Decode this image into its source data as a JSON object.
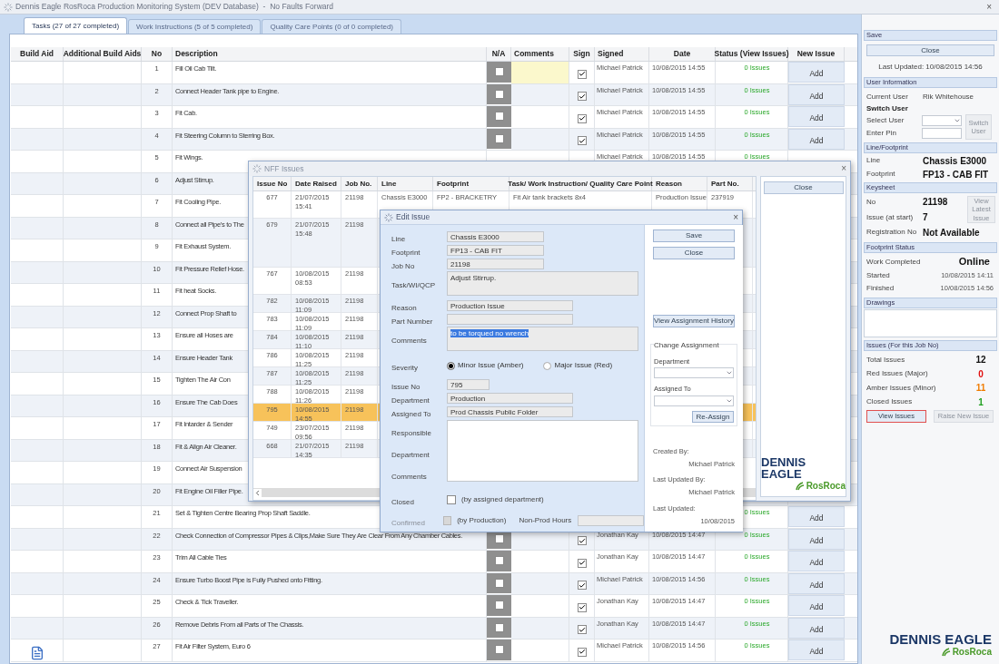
{
  "window": {
    "title": "Dennis Eagle RosRoca Production Monitoring System (DEV Database)  -  No Faults Forward",
    "close": "×"
  },
  "tabs": [
    {
      "label": "Tasks (27 of 27 completed)",
      "selected": true
    },
    {
      "label": "Work Instructions (5 of 5 completed)",
      "selected": false
    },
    {
      "label": "Quality Care Points (0 of 0 completed)",
      "selected": false
    }
  ],
  "tasks": {
    "columns": [
      "Build Aid",
      "Additional Build Aids",
      "No",
      "Description",
      "N/A",
      "Comments",
      "Sign",
      "Signed",
      "Date",
      "Status (View Issues)",
      "New Issue"
    ],
    "rows": [
      {
        "no": "1",
        "description": "Fill Oil Cab Tilt.",
        "attachment": false,
        "na": false,
        "editing": true,
        "sign": true,
        "signed": "Michael Patrick",
        "date": "10/08/2015 14:55",
        "status": "0 Issues",
        "add": "Add"
      },
      {
        "no": "2",
        "description": "Connect Header Tank pipe to Engine.",
        "attachment": false,
        "na": false,
        "editing": false,
        "sign": true,
        "signed": "Michael Patrick",
        "date": "10/08/2015 14:55",
        "status": "0 Issues",
        "add": "Add"
      },
      {
        "no": "3",
        "description": "Fit Cab.",
        "attachment": false,
        "na": false,
        "editing": false,
        "sign": true,
        "signed": "Michael Patrick",
        "date": "10/08/2015 14:55",
        "status": "0 Issues",
        "add": "Add"
      },
      {
        "no": "4",
        "description": "Fit Steering Column to Sterring Box.",
        "attachment": false,
        "na": false,
        "editing": false,
        "sign": true,
        "signed": "Michael Patrick",
        "date": "10/08/2015 14:55",
        "status": "0 Issues",
        "add": "Add"
      },
      {
        "no": "5",
        "description": "Fit Wings.",
        "attachment": false,
        "signed": "Michael Patrick",
        "date": "10/08/2015 14:55",
        "status": "0 Issues"
      },
      {
        "no": "6",
        "description": "Adjust Stirrup.",
        "attachment": false
      },
      {
        "no": "7",
        "description": "Fit Cooling Pipe.",
        "attachment": false
      },
      {
        "no": "8",
        "description": "Connect all Pipe's to The",
        "attachment": false
      },
      {
        "no": "9",
        "description": "Fit Exhaust System.",
        "attachment": false
      },
      {
        "no": "10",
        "description": "Fit Pressure Relief Hose.",
        "attachment": false
      },
      {
        "no": "11",
        "description": "Fit heat Socks.",
        "attachment": false
      },
      {
        "no": "12",
        "description": "Connect Prop Shaft to",
        "attachment": false
      },
      {
        "no": "13",
        "description": "Ensure all Hoses are",
        "attachment": false
      },
      {
        "no": "14",
        "description": "Ensure Header Tank",
        "attachment": false
      },
      {
        "no": "15",
        "description": "Tighten The Air Con",
        "attachment": false
      },
      {
        "no": "16",
        "description": "Ensure The Cab Does",
        "attachment": false
      },
      {
        "no": "17",
        "description": "Fit Intarder &  Sender",
        "attachment": false
      },
      {
        "no": "18",
        "description": "Fit & Align Air Cleaner.",
        "attachment": false
      },
      {
        "no": "19",
        "description": "Connect Air Suspension",
        "attachment": false
      },
      {
        "no": "20",
        "description": "Fit Engine Oil Filler Pipe.",
        "attachment": false
      },
      {
        "no": "21",
        "description": "Set & Tighten Centre Bearing Prop Shaft Saddle.",
        "attachment": false,
        "status": "0 Issues",
        "add": "Add"
      },
      {
        "no": "22",
        "description": "Check Connection of Compressor Pipes & Clips,Make Sure They Are Clear From Any Chamber Cables.",
        "attachment": false,
        "na": false,
        "editing": false,
        "sign": true,
        "signed": "Jonathan Kay",
        "date": "10/08/2015 14:47",
        "status": "0 Issues",
        "add": "Add"
      },
      {
        "no": "23",
        "description": "Trim All Cable Ties",
        "attachment": false,
        "na": false,
        "editing": false,
        "sign": true,
        "signed": "Jonathan Kay",
        "date": "10/08/2015 14:47",
        "status": "0 Issues",
        "add": "Add"
      },
      {
        "no": "24",
        "description": "Ensure Turbo Boost Pipe is Fully Pushed onto Fitting.",
        "attachment": false,
        "na": false,
        "editing": false,
        "sign": true,
        "signed": "Michael Patrick",
        "date": "10/08/2015 14:56",
        "status": "0 Issues",
        "add": "Add"
      },
      {
        "no": "25",
        "description": "Check & Tick Traveller.",
        "attachment": false,
        "na": false,
        "editing": false,
        "sign": true,
        "signed": "Jonathan Kay",
        "date": "10/08/2015 14:47",
        "status": "0 Issues",
        "add": "Add"
      },
      {
        "no": "26",
        "description": "Remove Debris From all Parts of The Chassis.",
        "attachment": false,
        "na": false,
        "editing": false,
        "sign": true,
        "signed": "Jonathan Kay",
        "date": "10/08/2015 14:47",
        "status": "0 Issues",
        "add": "Add"
      },
      {
        "no": "27",
        "description": "Fit Air Filter System, Euro 6",
        "attachment": true,
        "na": false,
        "editing": false,
        "sign": true,
        "signed": "Michael Patrick",
        "date": "10/08/2015 14:56",
        "status": "0 Issues",
        "add": "Add"
      }
    ]
  },
  "nff": {
    "title": "NFF Issues",
    "close": "×",
    "columns": [
      "Issue No",
      "Date Raised",
      "Job No.",
      "Line",
      "Footprint",
      "Task/ Work Instruction/ Quality Care Point",
      "Reason",
      "Part No."
    ],
    "rows": [
      {
        "issue_no": "677",
        "date": "21/07/2015 15:41",
        "job": "21198",
        "line": "Chassis E3000",
        "footprint": "FP2 - BRACKETRY",
        "task": "Fit Air tank brackets 8x4",
        "reason": "Production Issue",
        "part": "237919",
        "selected": false
      },
      {
        "issue_no": "679",
        "date": "21/07/2015 15:48",
        "job": "21198",
        "selected": false
      },
      {
        "issue_no": "767",
        "date": "10/08/2015 08:53",
        "job": "21198",
        "selected": false
      },
      {
        "issue_no": "782",
        "date": "10/08/2015 11:09",
        "job": "21198",
        "selected": false
      },
      {
        "issue_no": "783",
        "date": "10/08/2015 11:09",
        "job": "21198",
        "selected": false
      },
      {
        "issue_no": "784",
        "date": "10/08/2015 11:10",
        "job": "21198",
        "selected": false
      },
      {
        "issue_no": "786",
        "date": "10/08/2015 11:25",
        "job": "21198",
        "selected": false
      },
      {
        "issue_no": "787",
        "date": "10/08/2015 11:25",
        "job": "21198",
        "selected": false
      },
      {
        "issue_no": "788",
        "date": "10/08/2015 11:26",
        "job": "21198",
        "selected": false
      },
      {
        "issue_no": "795",
        "date": "10/08/2015 14:55",
        "job": "21198",
        "selected": true
      },
      {
        "issue_no": "749",
        "date": "23/07/2015 09:56",
        "job": "21198",
        "selected": false
      },
      {
        "issue_no": "668",
        "date": "21/07/2015 14:35",
        "job": "21198",
        "selected": false
      }
    ],
    "close_button": "Close",
    "logo": {
      "name": "DENNIS EAGLE",
      "sub": "RosRoca"
    }
  },
  "edit": {
    "title": "Edit Issue",
    "close": "×",
    "fields": [
      {
        "kind": "text",
        "label": "Line",
        "value": "Chassis E3000"
      },
      {
        "kind": "text",
        "label": "Footprint",
        "value": "FP13 - CAB FIT"
      },
      {
        "kind": "text",
        "label": "Job No",
        "value": "21198"
      },
      {
        "kind": "area",
        "label": "Task/WI/QCP",
        "value": "Adjust Stirrup.",
        "highlighted": false
      },
      {
        "kind": "wide",
        "label": "Reason",
        "value": "Production Issue"
      },
      {
        "kind": "wide",
        "label": "Part Number"
      },
      {
        "kind": "area",
        "label": "Comments",
        "value": "to be torqued no wrench",
        "highlighted": true
      },
      {
        "kind": "radio",
        "label": "Severity",
        "options": [
          {
            "label": "Minor Issue (Amber)",
            "selected": true
          },
          {
            "label": "Major Issue (Red)",
            "selected": false
          }
        ]
      },
      {
        "kind": "short",
        "label": "Issue No",
        "value": "795"
      },
      {
        "kind": "wide",
        "label": "Department",
        "value": "Production"
      },
      {
        "kind": "wide",
        "label": "Assigned To",
        "value": "Prod Chassis Public Folder"
      },
      {
        "kind": "memo",
        "label": "Responsible Department Comments"
      },
      {
        "kind": "check",
        "label": "Closed",
        "checked": false,
        "disabled": false,
        "caption": "(by assigned department)"
      },
      {
        "kind": "check",
        "label": "Confirmed",
        "checked": false,
        "disabled": true,
        "caption": "(by Production)",
        "extra_label": "Non-Prod Hours"
      }
    ],
    "buttons": [
      "Save",
      "Close"
    ],
    "history_button": "View Assignment History",
    "change": {
      "title": "Change Assignment",
      "department_label": "Department",
      "assigned_label": "Assigned To",
      "button": "Re-Assign"
    },
    "audit": [
      {
        "label": "Created By:",
        "value": "Michael Patrick"
      },
      {
        "label": "Last Updated By:",
        "value": "Michael Patrick"
      },
      {
        "label": "Last Updated:",
        "value": "10/08/2015"
      }
    ]
  },
  "side": {
    "save_header": "Save",
    "close_button": "Close",
    "last_updated": "Last Updated: 10/08/2015 14:56",
    "user": {
      "header": "User Information",
      "current_label": "Current User",
      "current": "Rik Whitehouse",
      "switch_title": "Switch User",
      "select_label": "Select User",
      "pin_label": "Enter Pin",
      "switch_button": {
        "label": "Switch User",
        "disabled": true
      }
    },
    "line": {
      "header": "Line/Footprint",
      "rows": [
        {
          "label": "Line",
          "value": "Chassis E3000"
        },
        {
          "label": "Footprint",
          "value": "FP13  - CAB FIT"
        }
      ]
    },
    "keysheet": {
      "header": "Keysheet",
      "no_label": "No",
      "no": "21198",
      "issue_label": "Issue (at start)",
      "issue": "7",
      "latest_button": {
        "label": "View Latest Issue",
        "disabled": true
      },
      "reg_label": "Registration No",
      "reg": "Not Available"
    },
    "status": {
      "header": "Footprint Status",
      "work_label": "Work Completed",
      "work": "Online",
      "rows": [
        {
          "label": "Started",
          "value": "10/08/2015 14:11"
        },
        {
          "label": "Finished",
          "value": "10/08/2015 14:56"
        }
      ]
    },
    "drawings": {
      "header": "Drawings"
    },
    "issues": {
      "header": "Issues (For this Job No)",
      "rows": [
        {
          "label": "Total Issues",
          "value": "12",
          "color": "#111111"
        },
        {
          "label": "Red Issues (Major)",
          "value": "0",
          "color": "#e01010"
        },
        {
          "label": "Amber Issues (Minor)",
          "value": "11",
          "color": "#f07c00"
        },
        {
          "label": "Closed Issues",
          "value": "1",
          "color": "#20a020"
        }
      ],
      "buttons": [
        {
          "label": "View Issues",
          "disabled": false,
          "focused": true
        },
        {
          "label": "Raise New Issue",
          "disabled": true,
          "focused": false
        }
      ]
    },
    "logo": {
      "name": "DENNIS EAGLE",
      "sub": "RosRoca"
    }
  }
}
